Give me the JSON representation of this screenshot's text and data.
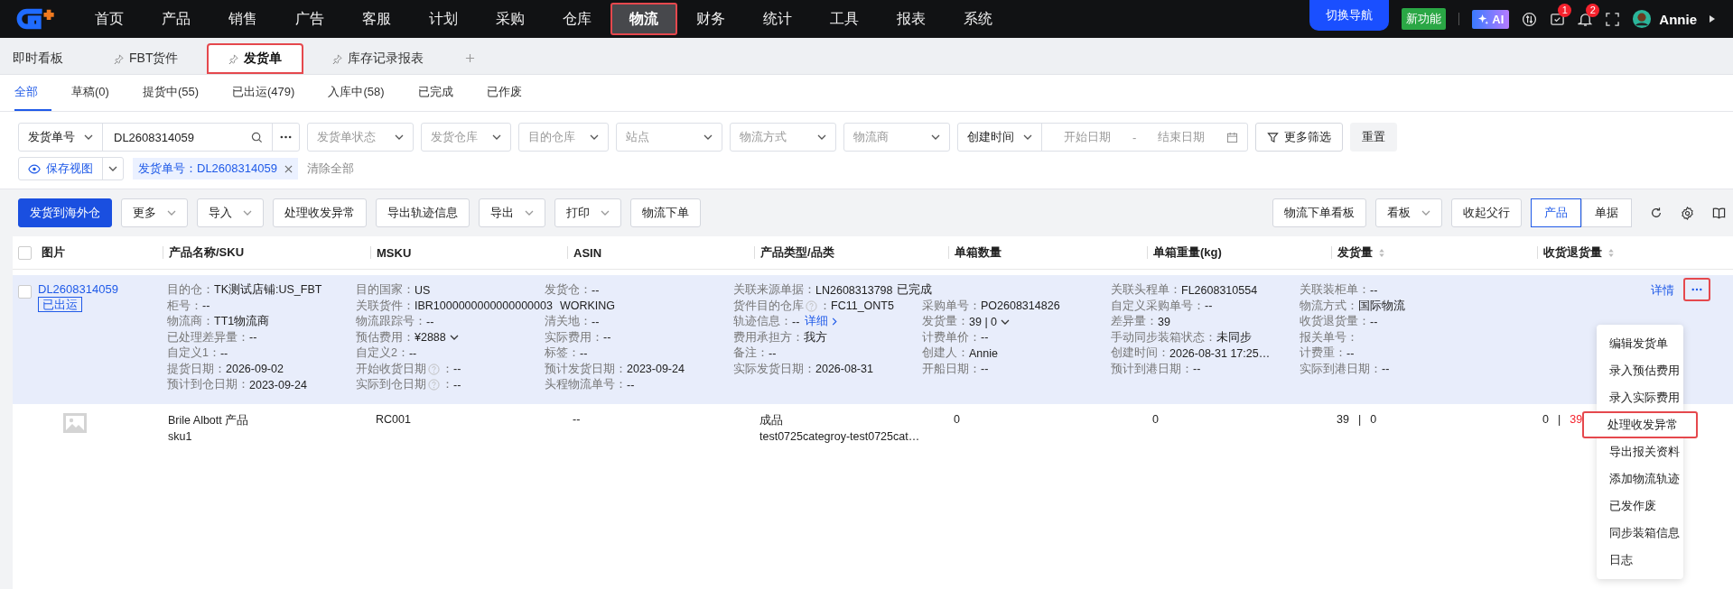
{
  "top_nav": {
    "items": [
      {
        "label": "首页",
        "selected": false,
        "highlighted": false
      },
      {
        "label": "产品",
        "selected": false,
        "highlighted": false
      },
      {
        "label": "销售",
        "selected": false,
        "highlighted": false
      },
      {
        "label": "广告",
        "selected": false,
        "highlighted": false
      },
      {
        "label": "客服",
        "selected": false,
        "highlighted": false
      },
      {
        "label": "计划",
        "selected": false,
        "highlighted": false
      },
      {
        "label": "采购",
        "selected": false,
        "highlighted": false
      },
      {
        "label": "仓库",
        "selected": false,
        "highlighted": false
      },
      {
        "label": "物流",
        "selected": true,
        "highlighted": true
      },
      {
        "label": "财务",
        "selected": false,
        "highlighted": false
      },
      {
        "label": "统计",
        "selected": false,
        "highlighted": false
      },
      {
        "label": "工具",
        "selected": false,
        "highlighted": false
      },
      {
        "label": "报表",
        "selected": false,
        "highlighted": false
      },
      {
        "label": "系统",
        "selected": false,
        "highlighted": false
      }
    ],
    "switch_nav": "切换导航",
    "new_feature": "新功能",
    "ai": "AI",
    "badges": [
      {
        "kind": "tasks",
        "count": "1"
      },
      {
        "kind": "bell",
        "count": "2"
      }
    ],
    "user": "Annie"
  },
  "page_tabs": [
    {
      "label": "即时看板",
      "pinned": false,
      "selected": false,
      "highlighted": false
    },
    {
      "label": "FBT货件",
      "pinned": true,
      "selected": false,
      "highlighted": false
    },
    {
      "label": "发货单",
      "pinned": true,
      "selected": true,
      "highlighted": true
    },
    {
      "label": "库存记录报表",
      "pinned": true,
      "selected": false,
      "highlighted": false
    }
  ],
  "status_tabs": [
    {
      "label": "全部",
      "selected": true
    },
    {
      "label": "草稿(0)",
      "selected": false
    },
    {
      "label": "提货中(55)",
      "selected": false
    },
    {
      "label": "已出运(479)",
      "selected": false
    },
    {
      "label": "入库中(58)",
      "selected": false
    },
    {
      "label": "已完成",
      "selected": false
    },
    {
      "label": "已作废",
      "selected": false
    }
  ],
  "filters": {
    "search_type": "发货单号",
    "search_value": "DL2608314059",
    "selects": [
      "发货单状态",
      "发货仓库",
      "目的仓库",
      "站点",
      "物流方式",
      "物流商"
    ],
    "date_type": "创建时间",
    "start_placeholder": "开始日期",
    "date_separator": "-",
    "end_placeholder": "结束日期",
    "more": "更多筛选",
    "reset": "重置"
  },
  "chips": {
    "save_view": "保存视图",
    "tags": [
      "发货单号：DL2608314059"
    ],
    "clear": "清除全部"
  },
  "toolbar": {
    "left": [
      {
        "label": "发货到海外仓",
        "kind": "primary"
      },
      {
        "label": "更多",
        "kind": "dropdown"
      },
      {
        "label": "导入",
        "kind": "dropdown"
      },
      {
        "label": "处理收发异常",
        "kind": "plain"
      },
      {
        "label": "导出轨迹信息",
        "kind": "plain"
      },
      {
        "label": "导出",
        "kind": "dropdown"
      },
      {
        "label": "打印",
        "kind": "dropdown"
      },
      {
        "label": "物流下单",
        "kind": "plain"
      }
    ],
    "right": [
      {
        "label": "物流下单看板",
        "kind": "plain"
      },
      {
        "label": "看板",
        "kind": "dropdown"
      },
      {
        "label": "收起父行",
        "kind": "plain"
      }
    ],
    "view_toggle": [
      {
        "label": "产品",
        "selected": true
      },
      {
        "label": "单据",
        "selected": false
      }
    ]
  },
  "table": {
    "select_all_checked": false,
    "columns": [
      {
        "label": "图片",
        "sortable": false
      },
      {
        "label": "产品名称/SKU",
        "sortable": false
      },
      {
        "label": "MSKU",
        "sortable": false
      },
      {
        "label": "ASIN",
        "sortable": false
      },
      {
        "label": "产品类型/品类",
        "sortable": false
      },
      {
        "label": "单箱数量",
        "sortable": false
      },
      {
        "label": "单箱重量(kg)",
        "sortable": false
      },
      {
        "label": "发货量",
        "sortable": true
      },
      {
        "label": "收货退货量",
        "sortable": true
      }
    ],
    "shipment": {
      "checked": false,
      "id": "DL2608314059",
      "status": "已出运",
      "detail": "详情",
      "rows": [
        [
          {
            "kind": "text",
            "label": "目的仓：",
            "value": "TK测试店铺:US_FBT"
          },
          {
            "kind": "text",
            "label": "目的国家：",
            "value": "US"
          },
          {
            "kind": "text",
            "label": "发货仓：",
            "value": "--"
          },
          {
            "kind": "source",
            "label": "关联来源单据：",
            "value": "LN2608313798",
            "status": "已完成"
          },
          "",
          {
            "kind": "text",
            "label": "关联头程单：",
            "value": "FL2608310554"
          },
          {
            "kind": "text",
            "label": "关联装柜单：",
            "value": "--"
          }
        ],
        [
          {
            "kind": "text",
            "label": "柜号：",
            "value": "--"
          },
          {
            "kind": "status",
            "label": "关联货件：",
            "value": "IBR1000000000000000003",
            "status": "WORKING"
          },
          "",
          {
            "kind": "help",
            "label": "货件目的仓库",
            "colon": "：",
            "value": "FC11_ONT5"
          },
          {
            "kind": "text",
            "label": "采购单号：",
            "value": "PO2608314826"
          },
          {
            "kind": "text",
            "label": "自定义采购单号：",
            "value": "--"
          },
          {
            "kind": "text",
            "label": "物流方式：",
            "value": "国际物流"
          }
        ],
        [
          {
            "kind": "text",
            "label": "物流商：",
            "value": "TT1物流商"
          },
          {
            "kind": "text",
            "label": "物流跟踪号：",
            "value": "--"
          },
          {
            "kind": "text",
            "label": "清关地：",
            "value": "--"
          },
          {
            "kind": "link",
            "label": "轨迹信息：",
            "value": "--",
            "link": "详细"
          },
          {
            "kind": "dropdown",
            "label": "发货量：",
            "value": "39 | 0"
          },
          {
            "kind": "text",
            "label": "差异量：",
            "value": "39"
          },
          {
            "kind": "text",
            "label": "收货退货量：",
            "value": "--"
          }
        ],
        [
          {
            "kind": "text",
            "label": "已处理差异量：",
            "value": "--"
          },
          {
            "kind": "dropdown",
            "label": "预估费用：",
            "value": "¥2888"
          },
          {
            "kind": "text",
            "label": "实际费用：",
            "value": "--"
          },
          {
            "kind": "text",
            "label": "费用承担方：",
            "value": "我方"
          },
          {
            "kind": "text",
            "label": "计费单价：",
            "value": "--"
          },
          {
            "kind": "text",
            "label": "手动同步装箱状态：",
            "value": "未同步"
          },
          {
            "kind": "label",
            "label": "报关单号："
          }
        ],
        [
          {
            "kind": "text",
            "label": "自定义1：",
            "value": "--"
          },
          {
            "kind": "text",
            "label": "自定义2：",
            "value": "--"
          },
          {
            "kind": "text",
            "label": "标签：",
            "value": "--"
          },
          {
            "kind": "text",
            "label": "备注：",
            "value": "--"
          },
          {
            "kind": "text",
            "label": "创建人：",
            "value": "Annie"
          },
          {
            "kind": "text",
            "label": "创建时间：",
            "value": "2026-08-31 17:25…"
          },
          {
            "kind": "text",
            "label": "计费重：",
            "value": "--"
          }
        ],
        [
          {
            "kind": "text",
            "label": "提货日期：",
            "value": "2026-09-02"
          },
          {
            "kind": "help",
            "label": "开始收货日期",
            "colon": "：",
            "value": "--"
          },
          {
            "kind": "text",
            "label": "预计发货日期：",
            "value": "2023-09-24"
          },
          {
            "kind": "text",
            "label": "实际发货日期：",
            "value": "2026-08-31"
          },
          {
            "kind": "text",
            "label": "开船日期：",
            "value": "--"
          },
          {
            "kind": "text",
            "label": "预计到港日期：",
            "value": "--"
          },
          {
            "kind": "text",
            "label": "实际到港日期：",
            "value": "--"
          }
        ],
        [
          {
            "kind": "text",
            "label": "预计到仓日期：",
            "value": "2023-09-24"
          },
          {
            "kind": "help",
            "label": "实际到仓日期",
            "colon": "：",
            "value": "--"
          },
          {
            "kind": "text",
            "label": "头程物流单号：",
            "value": "--"
          }
        ]
      ]
    },
    "products": [
      {
        "name": "Brile Albott 产品",
        "sku": "sku1",
        "msku": "RC001",
        "asin": "--",
        "type": "成品",
        "category": "test0725categroy-test0725cat…",
        "box_qty": "0",
        "box_weight": "0",
        "shipped": "39",
        "shipped_separator": "|",
        "shipped_extra": "0",
        "received": "0",
        "received_separator": "|",
        "returned": "39"
      }
    ]
  },
  "action_menu": {
    "items": [
      {
        "label": "编辑发货单",
        "highlighted": false
      },
      {
        "label": "录入预估费用",
        "highlighted": false
      },
      {
        "label": "录入实际费用",
        "highlighted": false
      },
      {
        "label": "处理收发异常",
        "highlighted": true
      },
      {
        "label": "导出报关资料",
        "highlighted": false
      },
      {
        "label": "添加物流轨迹",
        "highlighted": false
      },
      {
        "label": "已发作废",
        "highlighted": false
      },
      {
        "label": "同步装箱信息",
        "highlighted": false
      },
      {
        "label": "日志",
        "highlighted": false
      }
    ],
    "highlighted": true
  }
}
